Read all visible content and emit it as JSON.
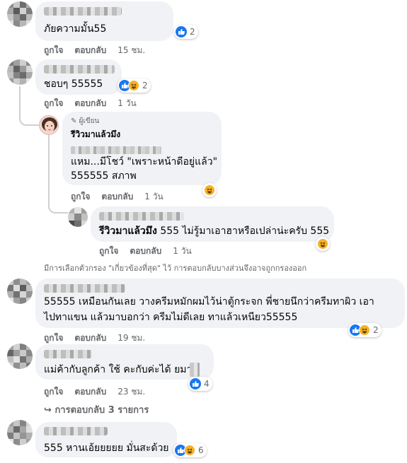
{
  "comments": [
    {
      "text": "ภัยความมั้น55",
      "like": "ถูกใจ",
      "reply": "ตอบกลับ",
      "time": "15 ชม.",
      "reactions": "2"
    },
    {
      "text": "ชอบๆ 55555",
      "like": "ถูกใจ",
      "reply": "ตอบกลับ",
      "time": "1 วัน",
      "reactions": "2"
    },
    {
      "author_badge": "ผู้เขียน",
      "author": "รีวิวมาแล้วมึง",
      "line1": "แหม...มีโชว์ \"เพราะหน้าดีอยู่แล้ว\"",
      "line2": "555555 สภาพ",
      "like": "ถูกใจ",
      "reply": "ตอบกลับ",
      "time": "1 วัน"
    },
    {
      "mention": "รีวิวมาแล้วมึง",
      "text": " 555 ไม่รู้มาเอาฮาหรือเปล่าน่ะครับ 555",
      "like": "ถูกใจ",
      "reply": "ตอบกลับ",
      "time": "1 วัน"
    },
    {
      "line1": "55555 เหมือนกันเลย วางครีมหมักผมไว้น่าตู้กระจก พี่ชายนึกว่าครีมทาผิว เอา",
      "line2": "ไปทาแขน แล้วมาบอกว่า ครีมไม่ดีเลย ทาแล้วเหนียว55555",
      "like": "ถูกใจ",
      "reply": "ตอบกลับ",
      "time": "19 ชม.",
      "reactions": "2"
    },
    {
      "text": "แม่ค้ากับลูกค้า ใช้ คะกับค่ะได้  ยมาก",
      "like": "ถูกใจ",
      "reply": "ตอบกลับ",
      "time": "23 ชม.",
      "reactions": "4"
    },
    {
      "text": "555 หานเอ้ยยยยย มั่นสะด้วย",
      "reactions": "6"
    }
  ],
  "filter_note": "มีการเลือกตัวกรอง \"เกี่ยวข้องที่สุด\" ไว้ การตอบกลับบางส่วนจึงอาจถูกกรองออก",
  "more_replies": "การตอบกลับ 3 รายการ",
  "colors": {
    "bubble": "#f0f2f5",
    "like": "#1877f2",
    "haha": "#f7b125",
    "meta": "#65676b"
  }
}
